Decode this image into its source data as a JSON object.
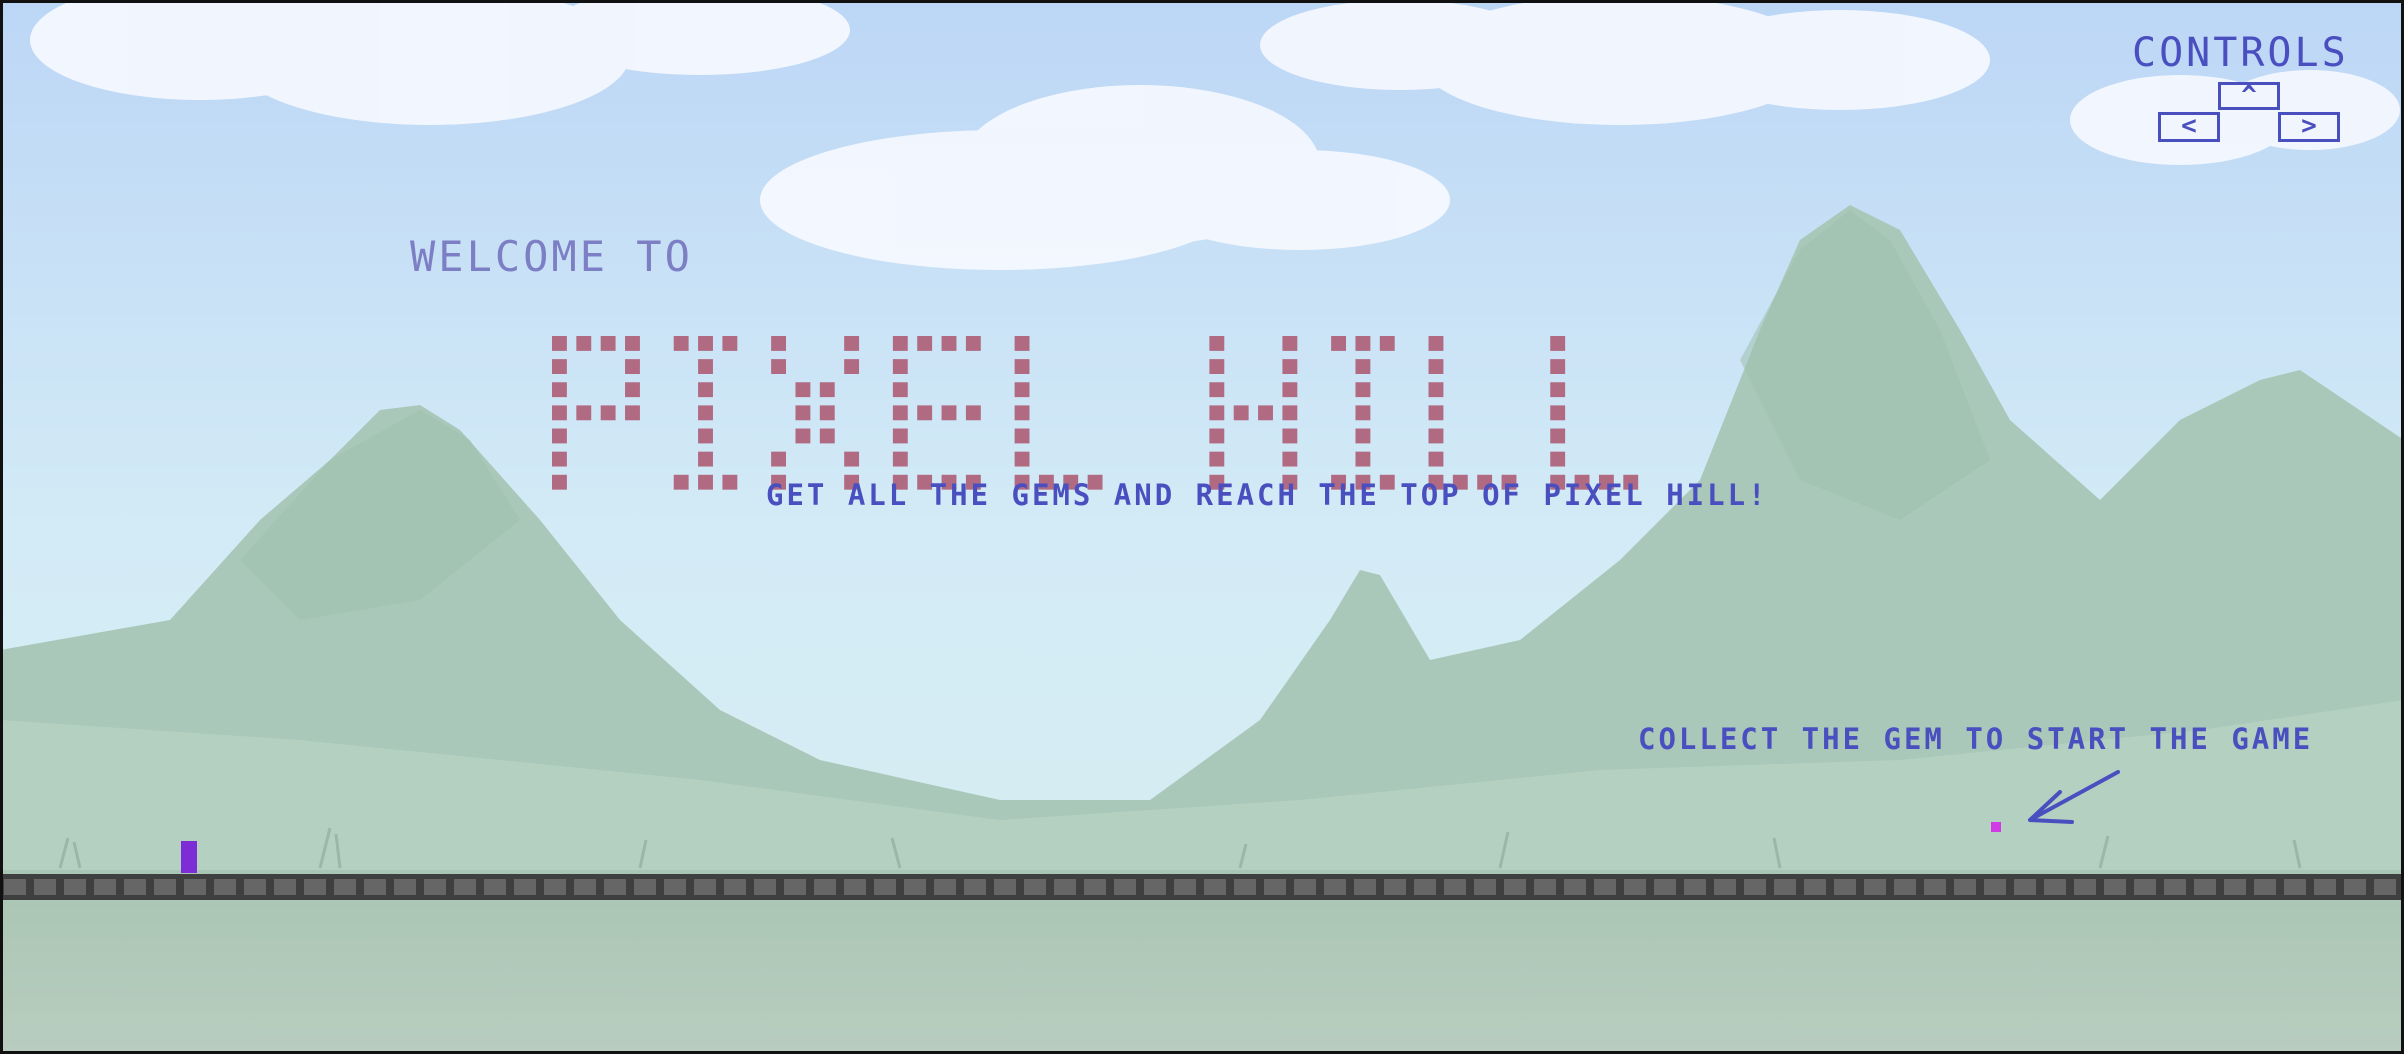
{
  "title_intro": "WELCOME TO",
  "game_title": "PIXEL HILL",
  "tagline": "GET ALL THE GEMS AND REACH THE TOP OF PIXEL HILL!",
  "start_hint": "COLLECT THE GEM TO START THE GAME",
  "controls": {
    "title": "CONTROLS",
    "up_key": "^",
    "left_key": "<",
    "right_key": ">"
  },
  "colors": {
    "ui_text": "#4a4fc0",
    "title_dots": "#b06a82",
    "player": "#7c2dd6",
    "gem": "#d23ae6",
    "ground": "#5a5a5a"
  }
}
